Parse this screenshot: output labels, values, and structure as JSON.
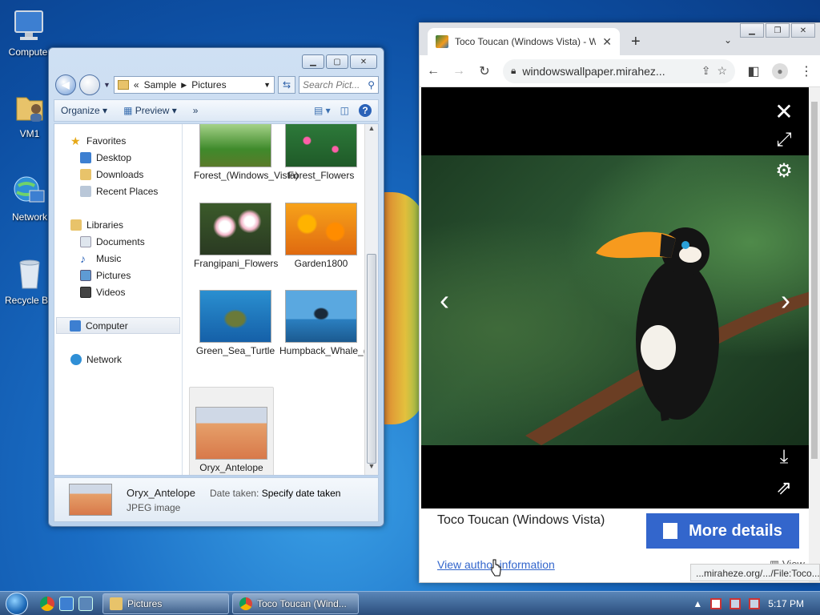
{
  "desktop": {
    "icons": [
      {
        "label": "Computer",
        "icon": "computer-icon"
      },
      {
        "label": "VM1",
        "icon": "user-folder-icon"
      },
      {
        "label": "Network",
        "icon": "network-icon"
      },
      {
        "label": "Recycle Bin",
        "icon": "recycle-bin-icon"
      }
    ]
  },
  "explorer": {
    "title": "Pictures",
    "breadcrumb": [
      "«",
      "Sample",
      "Pictures"
    ],
    "search_placeholder": "Search Pict...",
    "toolbar": {
      "organize": "Organize",
      "preview": "Preview",
      "more": "»"
    },
    "nav": {
      "favorites": "Favorites",
      "desktop": "Desktop",
      "downloads": "Downloads",
      "recent": "Recent Places",
      "libraries": "Libraries",
      "documents": "Documents",
      "music": "Music",
      "pictures": "Pictures",
      "videos": "Videos",
      "computer": "Computer",
      "network": "Network"
    },
    "files": [
      {
        "name": "Forest_(Windows_Vista)"
      },
      {
        "name": "Forest_Flowers"
      },
      {
        "name": "Frangipani_Flowers"
      },
      {
        "name": "Garden1800"
      },
      {
        "name": "Green_Sea_Turtle"
      },
      {
        "name": "Humpback_Whale_(Windows_Vista)"
      },
      {
        "name": "Oryx_Antelope",
        "selected": true
      }
    ],
    "details": {
      "name": "Oryx_Antelope",
      "type": "JPEG image",
      "date_label": "Date taken:",
      "date_value": "Specify date taken"
    }
  },
  "chrome": {
    "tab_title": "Toco Toucan (Windows Vista) - W",
    "url": "windowswallpaper.mirahez...",
    "caption": "Toco Toucan (Windows Vista)",
    "more_details": "More details",
    "author_link": "View author information",
    "view_link": "View",
    "status_url": "...miraheze.org/.../File:Toco..."
  },
  "taskbar": {
    "items": [
      {
        "label": "Pictures"
      },
      {
        "label": "Toco Toucan (Wind..."
      }
    ],
    "clock": "5:17 PM"
  },
  "colors": {
    "accent": "#3366cc",
    "taskbar": "#2b4e7c"
  }
}
